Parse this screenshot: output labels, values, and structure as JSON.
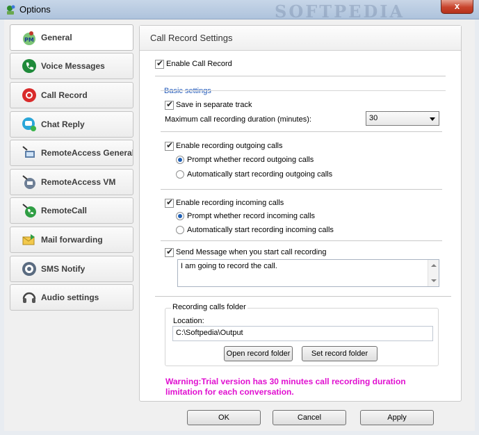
{
  "window": {
    "title": "Options",
    "watermark": "SOFTPEDIA",
    "close_glyph": "x"
  },
  "sidebar": {
    "items": [
      {
        "label": "General",
        "icon": "pm-icon",
        "selected": true
      },
      {
        "label": "Voice Messages",
        "icon": "voice-message-icon"
      },
      {
        "label": "Call Record",
        "icon": "record-icon"
      },
      {
        "label": "Chat Reply",
        "icon": "chat-icon"
      },
      {
        "label": "RemoteAccess General",
        "icon": "remote-access-icon"
      },
      {
        "label": "RemoteAccess VM",
        "icon": "remote-vm-icon"
      },
      {
        "label": "RemoteCall",
        "icon": "remote-call-icon"
      },
      {
        "label": "Mail forwarding",
        "icon": "mail-forward-icon"
      },
      {
        "label": "SMS Notify",
        "icon": "sms-icon"
      },
      {
        "label": "Audio settings",
        "icon": "headset-icon"
      }
    ]
  },
  "panel": {
    "title": "Call Record Settings",
    "enable_call_record": {
      "label": "Enable Call Record",
      "checked": true
    },
    "basic_settings": {
      "heading": "Basic settings",
      "save_separate": {
        "label": "Save in separate track",
        "checked": true
      },
      "max_duration_label": "Maximum call recording duration (minutes):",
      "max_duration_value": "30"
    },
    "outgoing": {
      "enable_label": "Enable recording outgoing calls",
      "prompt_label": "Prompt whether record outgoing calls",
      "auto_label": "Automatically start recording outgoing calls"
    },
    "incoming": {
      "enable_label": "Enable recording incoming calls",
      "prompt_label": "Prompt whether record incoming calls",
      "auto_label": "Automatically start recording incoming calls"
    },
    "send_message": {
      "label": "Send Message when you start call recording",
      "text": "I am going to record the call."
    },
    "folder": {
      "legend": "Recording calls folder",
      "location_label": "Location:",
      "location_value": "C:\\Softpedia\\Output",
      "open_button": "Open record folder",
      "set_button": "Set record folder"
    },
    "warning": "Warning:Trial version has 30 minutes call recording duration limitation for each conversation."
  },
  "footer": {
    "ok": "OK",
    "cancel": "Cancel",
    "apply": "Apply"
  },
  "colors": {
    "warning": "#e010d0",
    "heading": "#1f57b8",
    "radio_dot": "#1e5fb5"
  }
}
